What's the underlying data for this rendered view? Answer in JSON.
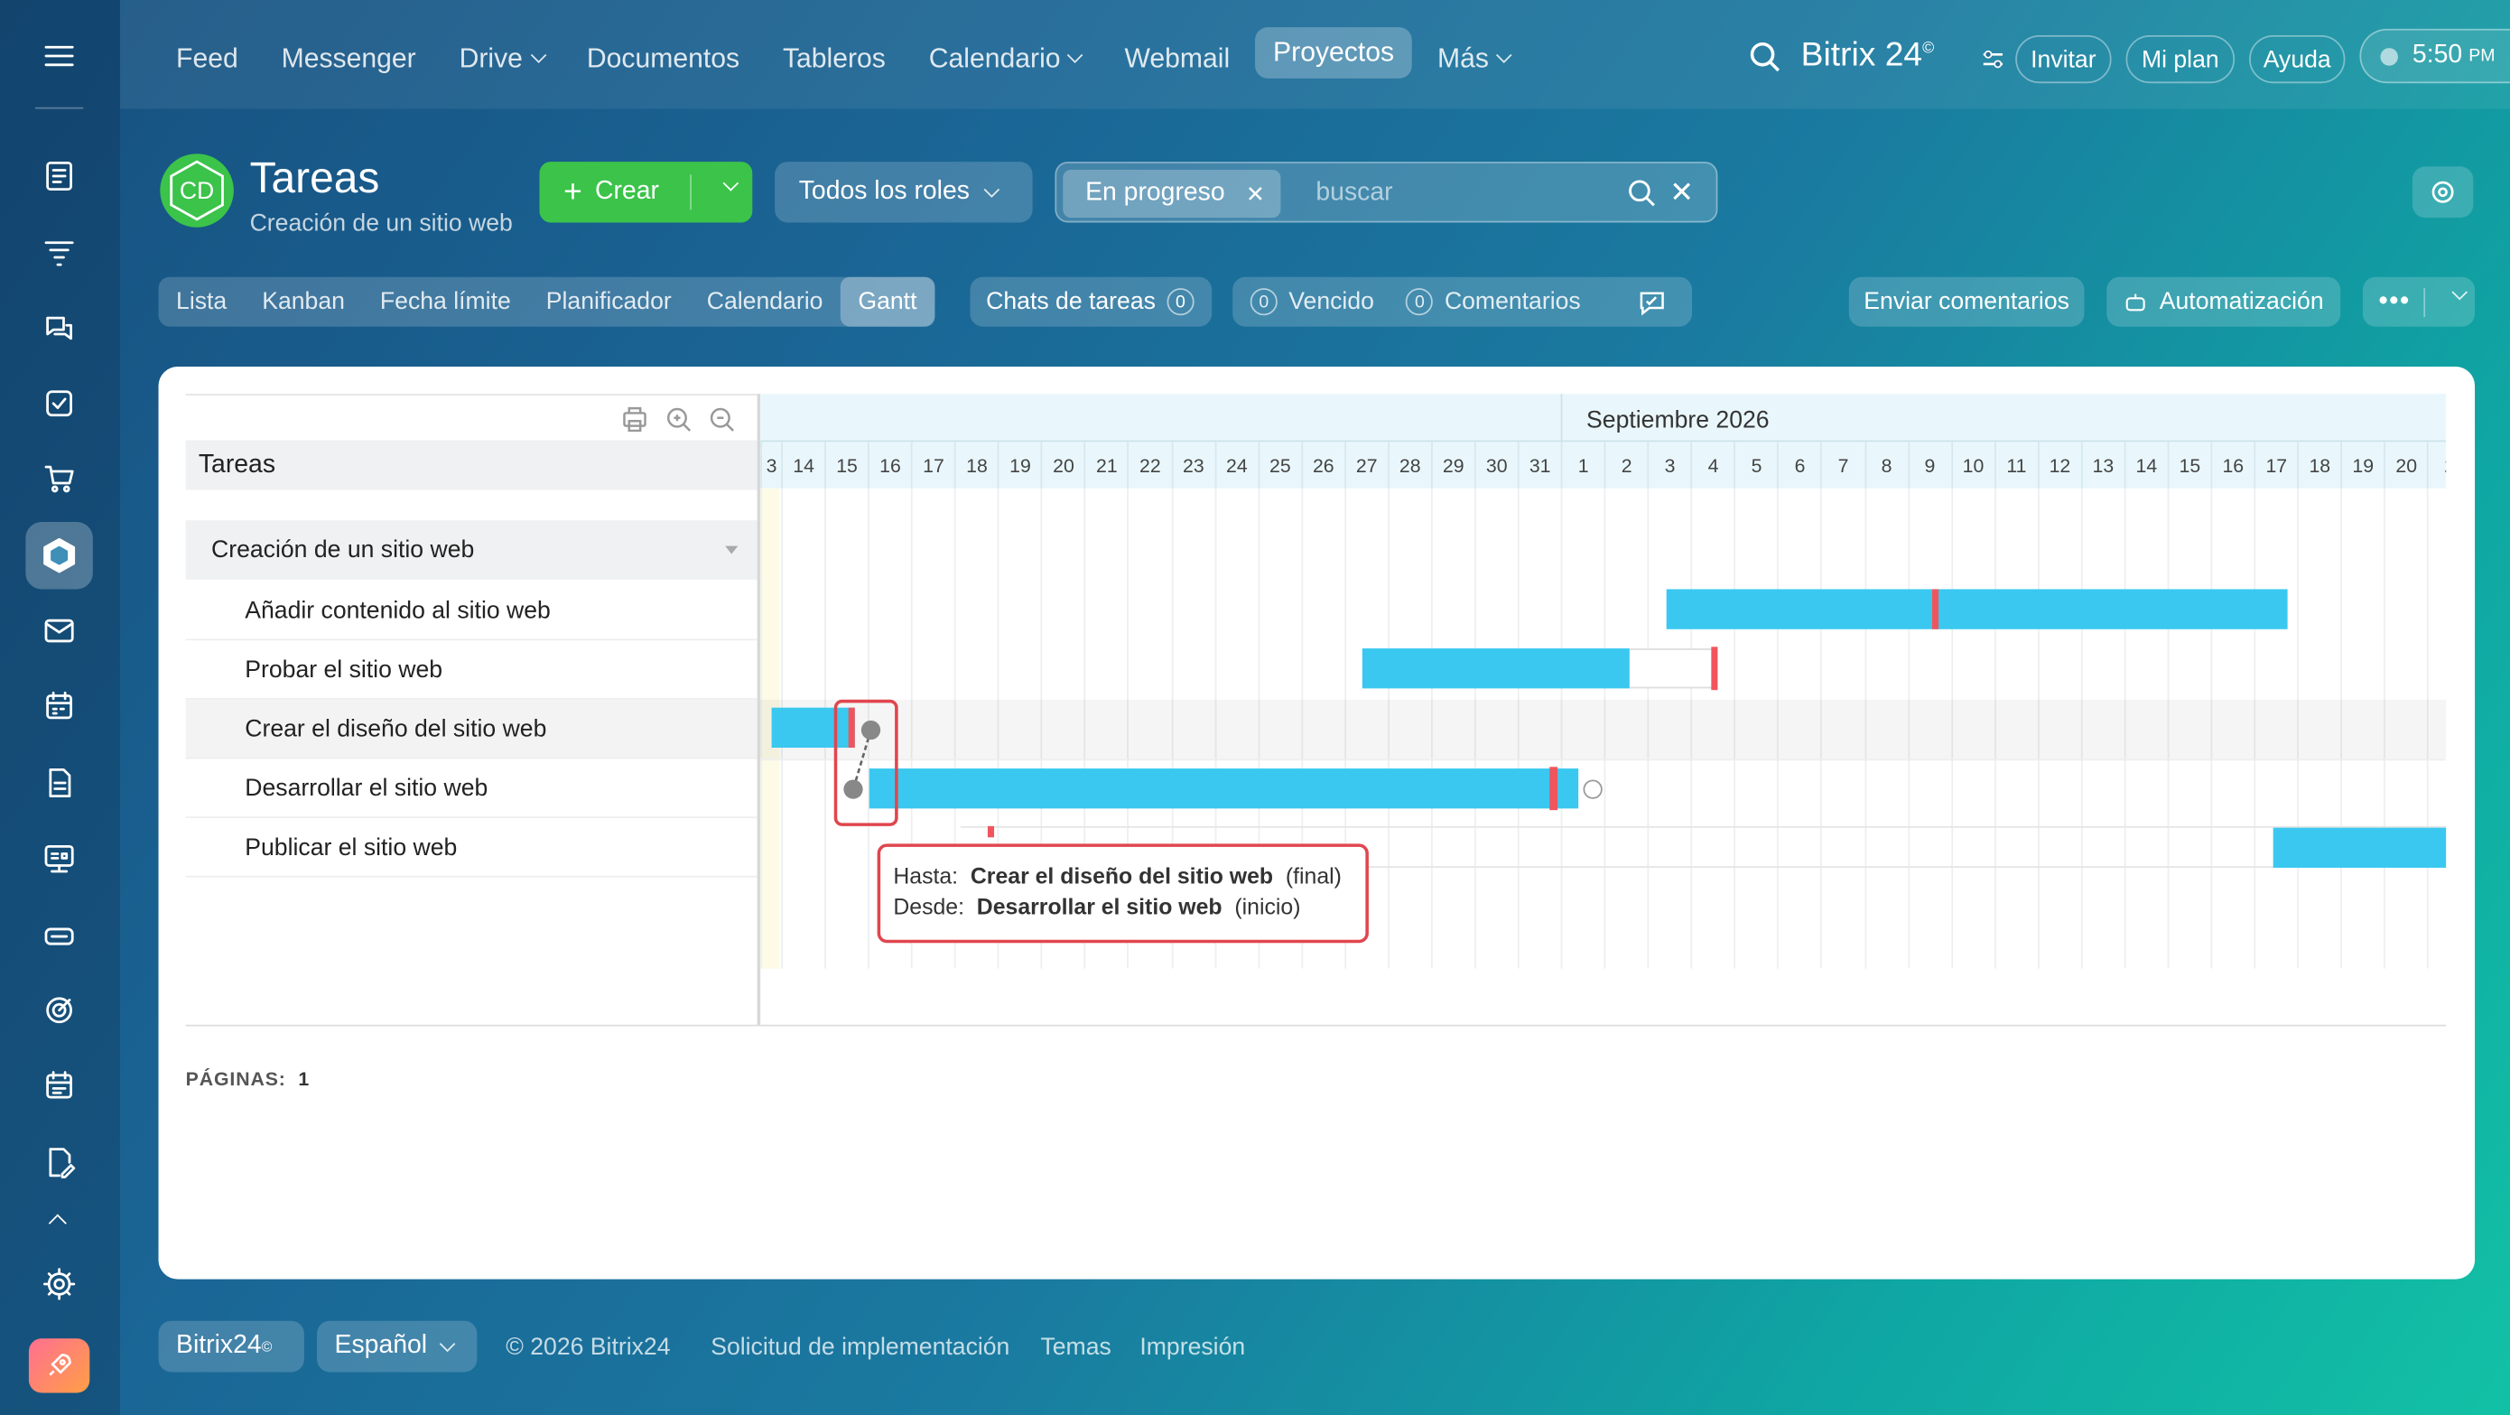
{
  "nav": {
    "feed": "Feed",
    "messenger": "Messenger",
    "drive": "Drive",
    "documentos": "Documentos",
    "tableros": "Tableros",
    "calendario": "Calendario",
    "webmail": "Webmail",
    "proyectos": "Proyectos",
    "mas": "Más"
  },
  "header": {
    "brand": "Bitrix 24",
    "brand_mark": "©",
    "invitar": "Invitar",
    "mi_plan": "Mi plan",
    "ayuda": "Ayuda",
    "clock": "5:50",
    "clock_suffix": "PM"
  },
  "project": {
    "avatar": "CD",
    "title": "Tareas",
    "subtitle": "Creación de un sitio web"
  },
  "toolbar": {
    "crear": "Crear",
    "roles": "Todos los roles",
    "filter_tag": "En progreso",
    "search_placeholder": "buscar"
  },
  "tabs": [
    "Lista",
    "Kanban",
    "Fecha límite",
    "Planificador",
    "Calendario",
    "Gantt"
  ],
  "counters": {
    "chats": "Chats de tareas",
    "chats_count": "0",
    "vencido_count": "0",
    "vencido": "Vencido",
    "coment_count": "0",
    "comentarios": "Comentarios"
  },
  "actions": {
    "enviar": "Enviar comentarios",
    "automatizacion": "Automatización"
  },
  "gantt": {
    "col_header": "Tareas",
    "month": "Septiembre 2026",
    "days": [
      "3",
      "14",
      "15",
      "16",
      "17",
      "18",
      "19",
      "20",
      "21",
      "22",
      "23",
      "24",
      "25",
      "26",
      "27",
      "28",
      "29",
      "30",
      "31",
      "1",
      "2",
      "3",
      "4",
      "5",
      "6",
      "7",
      "8",
      "9",
      "10",
      "11",
      "12",
      "13",
      "14",
      "15",
      "16",
      "17",
      "18",
      "19",
      "20",
      "2"
    ],
    "group": "Creación de un sitio web",
    "tasks": [
      "Añadir contenido al sitio web",
      "Probar el sitio web",
      "Crear el diseño del sitio web",
      "Desarrollar el sitio web",
      "Publicar el sitio web"
    ],
    "tooltip": {
      "to_label": "Hasta:",
      "to_task": "Crear el diseño del sitio web",
      "to_kind": "(final)",
      "from_label": "Desde:",
      "from_task": "Desarrollar el sitio web",
      "from_kind": "(inicio)"
    },
    "pages_label": "PÁGINAS:",
    "pages": "1"
  },
  "footer": {
    "brand": "Bitrix24",
    "lang": "Español",
    "copyright": "© 2026 Bitrix24",
    "solicitud": "Solicitud de implementación",
    "temas": "Temas",
    "impresion": "Impresión"
  },
  "colors": {
    "bar": "#3bc8f0",
    "deadline": "#f0555e",
    "highlight": "#e0464e",
    "accent_green": "#3bc34a"
  }
}
